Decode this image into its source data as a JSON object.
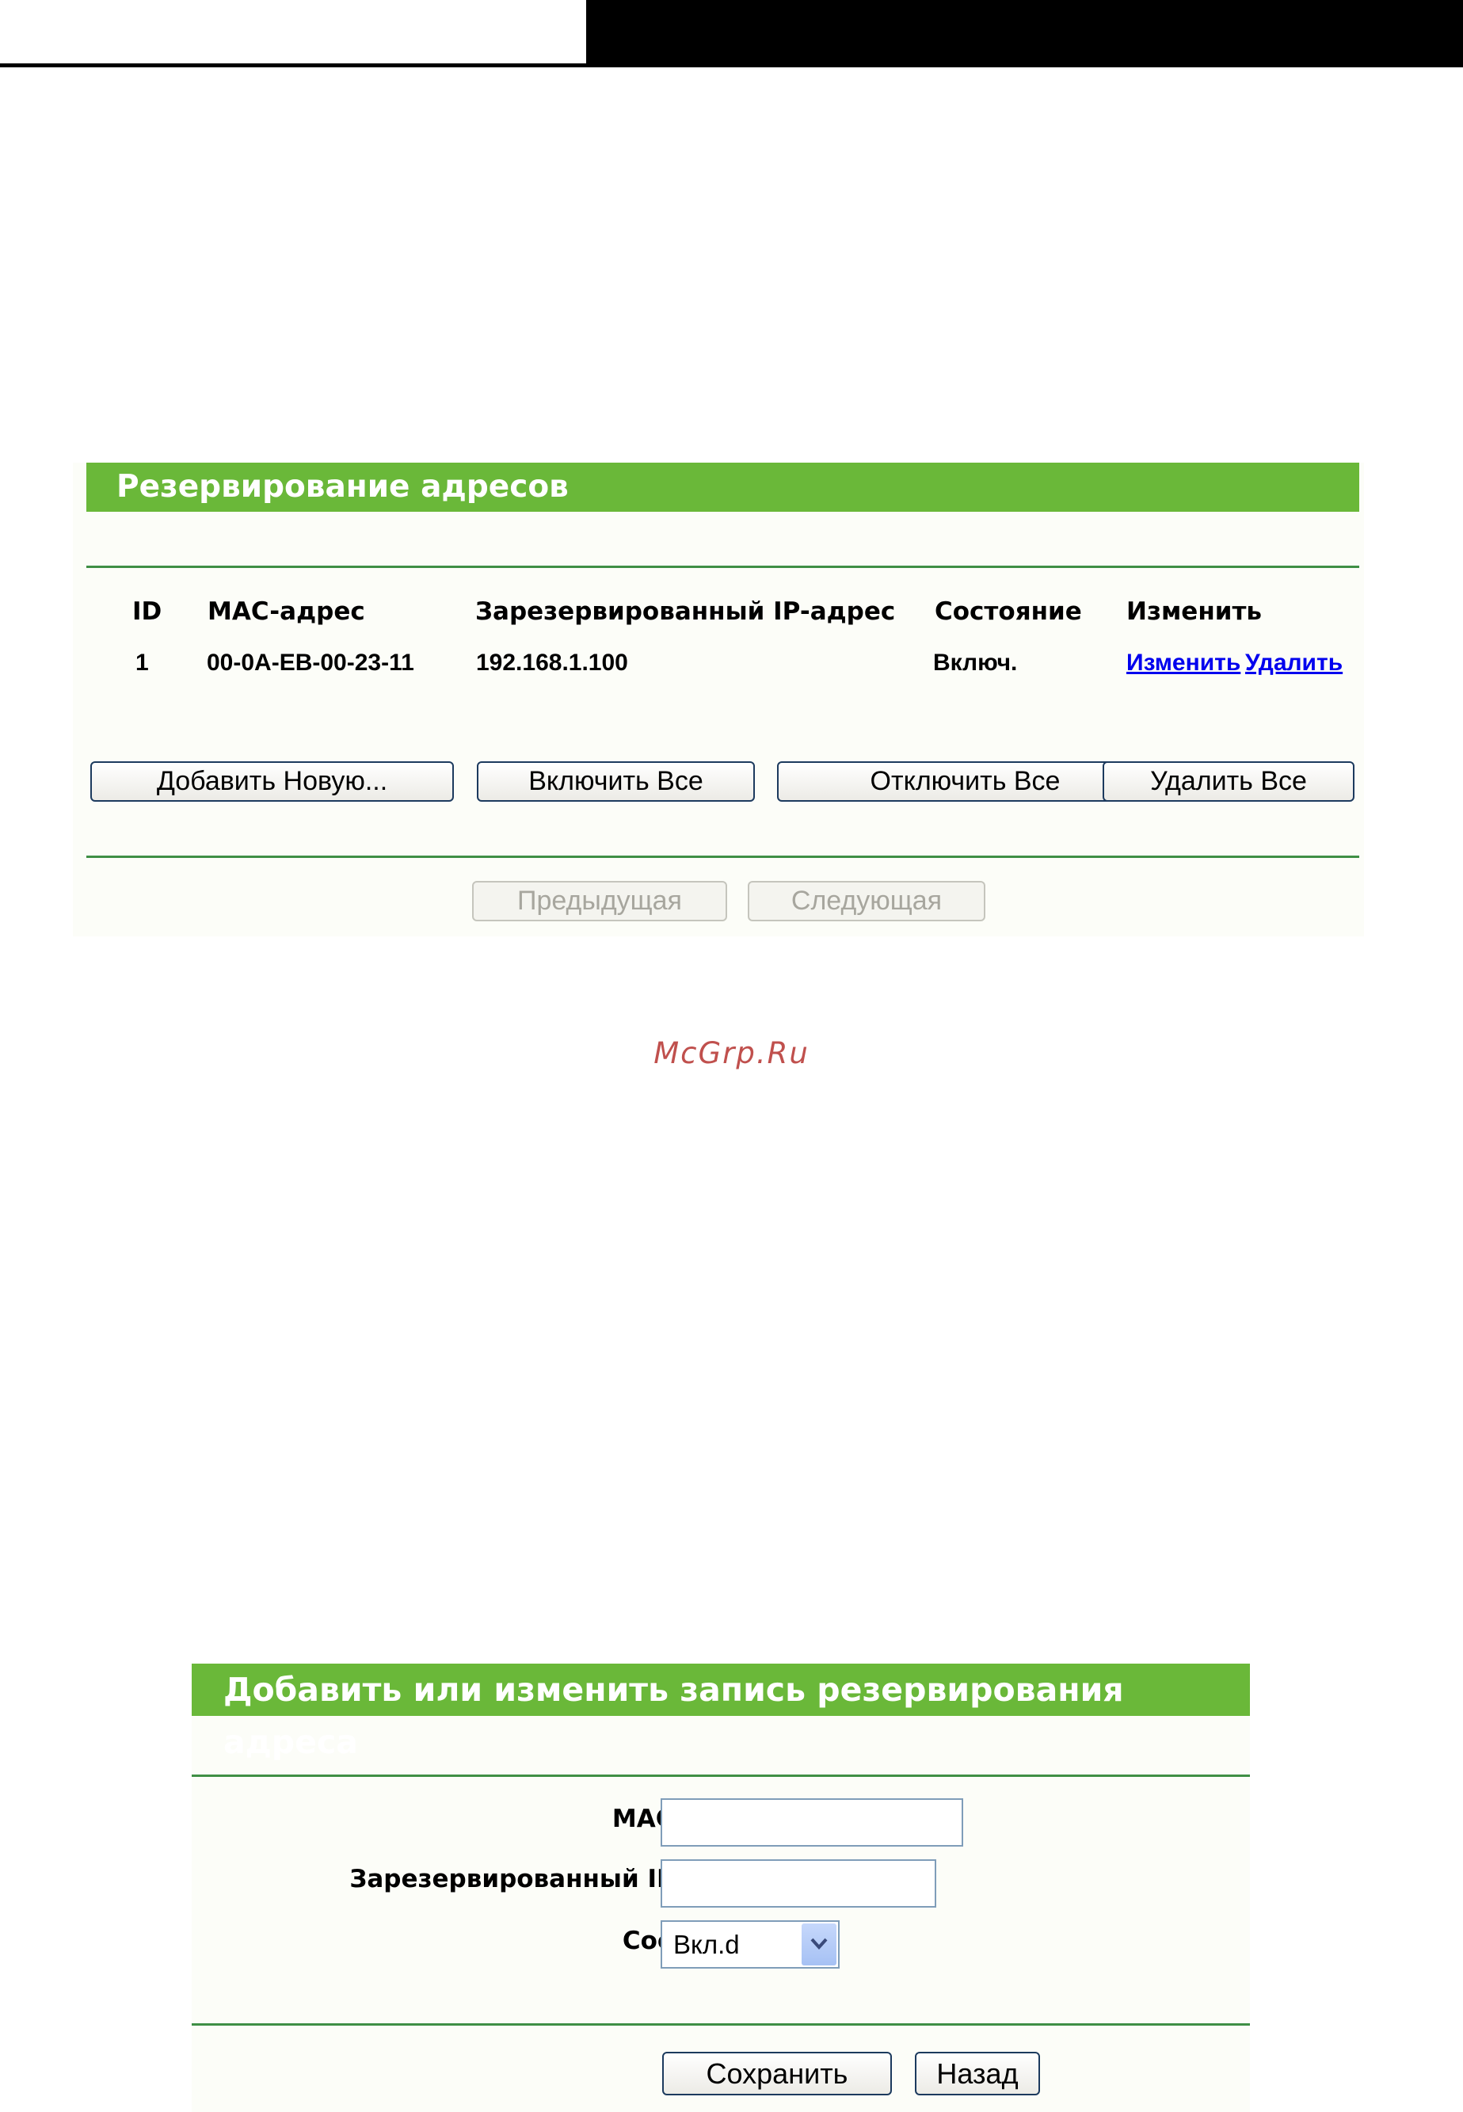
{
  "panel1": {
    "title": "Резервирование адресов",
    "columns": [
      "ID",
      "MAC-адрес",
      "Зарезервированный IP-адрес",
      "Состояние",
      "Изменить"
    ],
    "rows": [
      {
        "id": "1",
        "mac": "00-0A-EB-00-23-11",
        "ip": "192.168.1.100",
        "status": "Включ.",
        "edit_link": "Изменить",
        "delete_link": "Удалить"
      }
    ],
    "buttons": {
      "add_new": "Добавить Новую...",
      "enable_all": "Включить Все",
      "disable_all": "Отключить Все",
      "delete_all": "Удалить Все"
    },
    "pager": {
      "prev": "Предыдущая",
      "next": "Следующая"
    }
  },
  "watermark": "McGrp.Ru",
  "panel2": {
    "title": "Добавить или изменить запись резервирования адреса",
    "fields": {
      "mac_label": "MAC-адрес:",
      "mac_value": "",
      "ip_label": "Зарезервированный IP-адрес:",
      "ip_value": "",
      "status_label": "Состояние:",
      "status_value": "Вкл.d"
    },
    "buttons": {
      "save": "Сохранить",
      "back": "Назад"
    }
  },
  "colors": {
    "title_bar": "#6ab839",
    "rule": "#3f8f45",
    "panel_bg": "#fcfdf8",
    "link": "#0000ee",
    "watermark": "#c0504d"
  }
}
